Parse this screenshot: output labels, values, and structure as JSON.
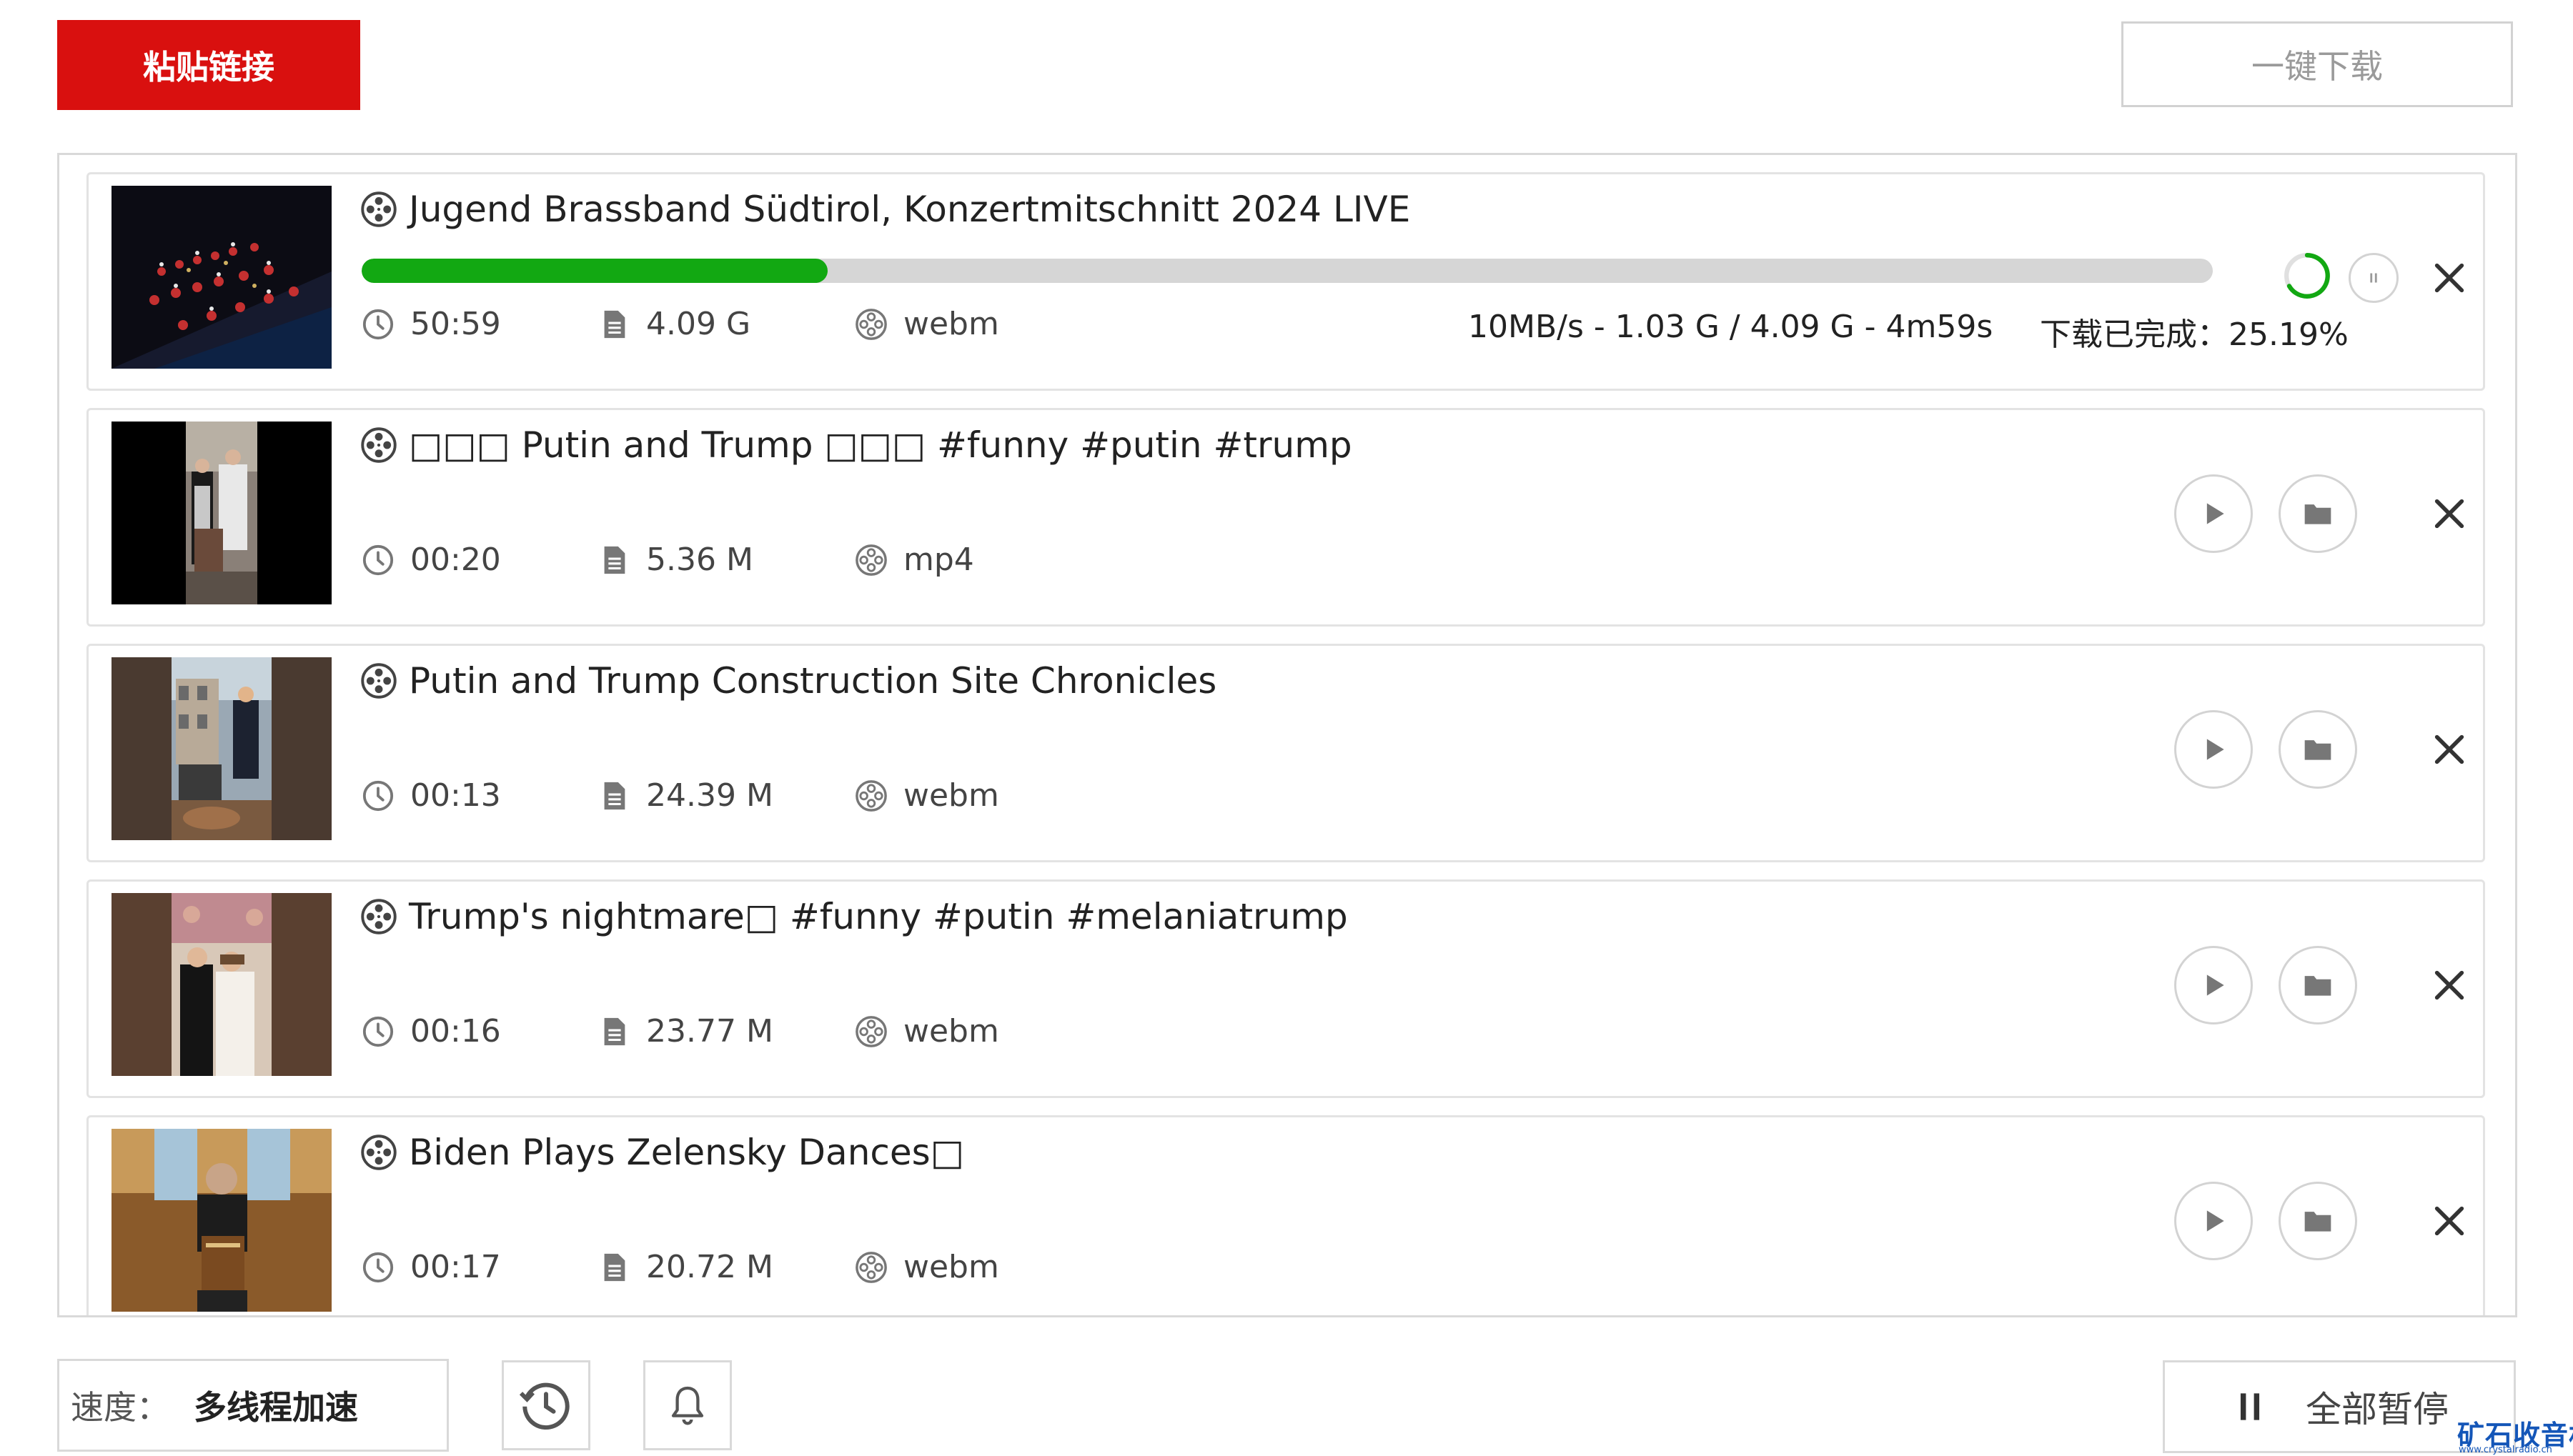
{
  "toolbar": {
    "paste_label": "粘贴链接",
    "onekey_label": "一键下载"
  },
  "items": [
    {
      "title": "Jugend Brassband Südtirol, Konzertmitschnitt 2024 LIVE",
      "duration": "50:59",
      "size": "4.09 G",
      "format": "webm",
      "status": "downloading",
      "progress_percent": 25.19,
      "speed_line": "10MB/s - 1.03 G / 4.09 G - 4m59s",
      "done_line": "下载已完成：25.19%"
    },
    {
      "title": "□□□ Putin and Trump □□□ #funny #putin #trump",
      "duration": "00:20",
      "size": "5.36 M",
      "format": "mp4",
      "status": "complete"
    },
    {
      "title": "Putin and Trump Construction Site Chronicles",
      "duration": "00:13",
      "size": "24.39 M",
      "format": "webm",
      "status": "complete"
    },
    {
      "title": "Trump's nightmare□ #funny #putin #melaniatrump",
      "duration": "00:16",
      "size": "23.77 M",
      "format": "webm",
      "status": "complete"
    },
    {
      "title": "Biden Plays Zelensky Dances□",
      "duration": "00:17",
      "size": "20.72 M",
      "format": "webm",
      "status": "complete"
    }
  ],
  "footer": {
    "speed_label": "速度：",
    "speed_value": "多线程加速",
    "pause_all_label": "全部暂停"
  },
  "watermark": {
    "main": "矿石收音机",
    "sub": "www.crystalradio.cn"
  },
  "colors": {
    "accent_red": "#d9100f",
    "progress_green": "#12a812",
    "watermark_blue": "#1456b8"
  },
  "icons": [
    "film-reel-icon",
    "clock-icon",
    "file-icon",
    "play-icon",
    "folder-icon",
    "close-icon",
    "pause-icon",
    "history-icon",
    "bell-icon",
    "spinner-icon"
  ]
}
